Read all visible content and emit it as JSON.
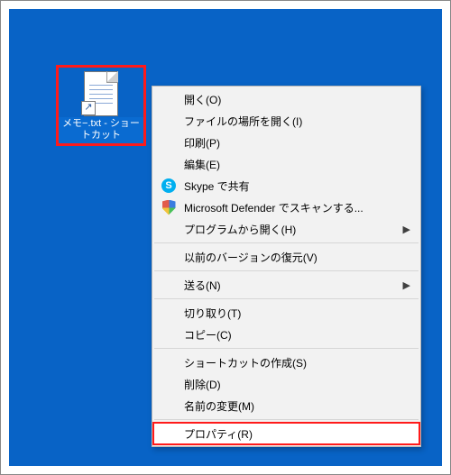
{
  "desktop": {
    "icon_label": "メモ−.txt - ショートカット"
  },
  "context_menu": {
    "items": [
      {
        "type": "item",
        "label": "開く(O)"
      },
      {
        "type": "item",
        "label": "ファイルの場所を開く(I)"
      },
      {
        "type": "item",
        "label": "印刷(P)"
      },
      {
        "type": "item",
        "label": "編集(E)"
      },
      {
        "type": "item",
        "label": "Skype で共有",
        "icon": "skype"
      },
      {
        "type": "item",
        "label": "Microsoft Defender でスキャンする...",
        "icon": "defender"
      },
      {
        "type": "item",
        "label": "プログラムから開く(H)",
        "submenu": true
      },
      {
        "type": "sep"
      },
      {
        "type": "item",
        "label": "以前のバージョンの復元(V)"
      },
      {
        "type": "sep"
      },
      {
        "type": "item",
        "label": "送る(N)",
        "submenu": true
      },
      {
        "type": "sep"
      },
      {
        "type": "item",
        "label": "切り取り(T)"
      },
      {
        "type": "item",
        "label": "コピー(C)"
      },
      {
        "type": "sep"
      },
      {
        "type": "item",
        "label": "ショートカットの作成(S)"
      },
      {
        "type": "item",
        "label": "削除(D)"
      },
      {
        "type": "item",
        "label": "名前の変更(M)"
      },
      {
        "type": "sep"
      },
      {
        "type": "item",
        "label": "プロパティ(R)",
        "highlighted": true
      }
    ]
  }
}
